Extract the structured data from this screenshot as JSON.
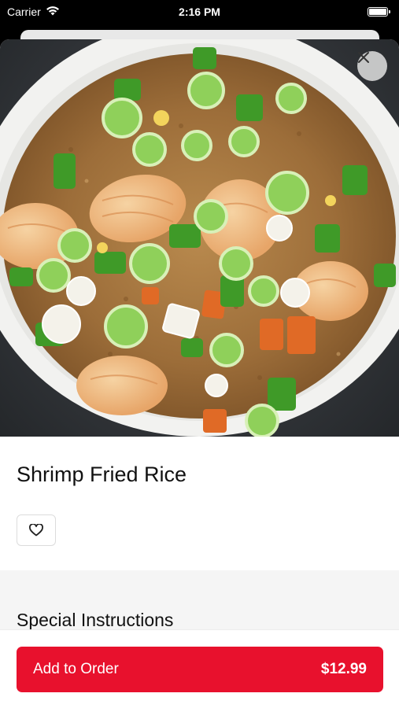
{
  "status_bar": {
    "carrier": "Carrier",
    "time": "2:16 PM"
  },
  "item": {
    "name": "Shrimp Fried Rice"
  },
  "instructions": {
    "label": "Special Instructions"
  },
  "order_button": {
    "label": "Add to Order",
    "price": "$12.99"
  },
  "colors": {
    "brand_red": "#e8112d",
    "sheet_bg": "#ffffff",
    "section_bg": "#f5f5f5"
  },
  "icons": {
    "close": "close-icon",
    "favorite": "heart-icon",
    "wifi": "wifi-icon",
    "battery": "battery-icon"
  }
}
